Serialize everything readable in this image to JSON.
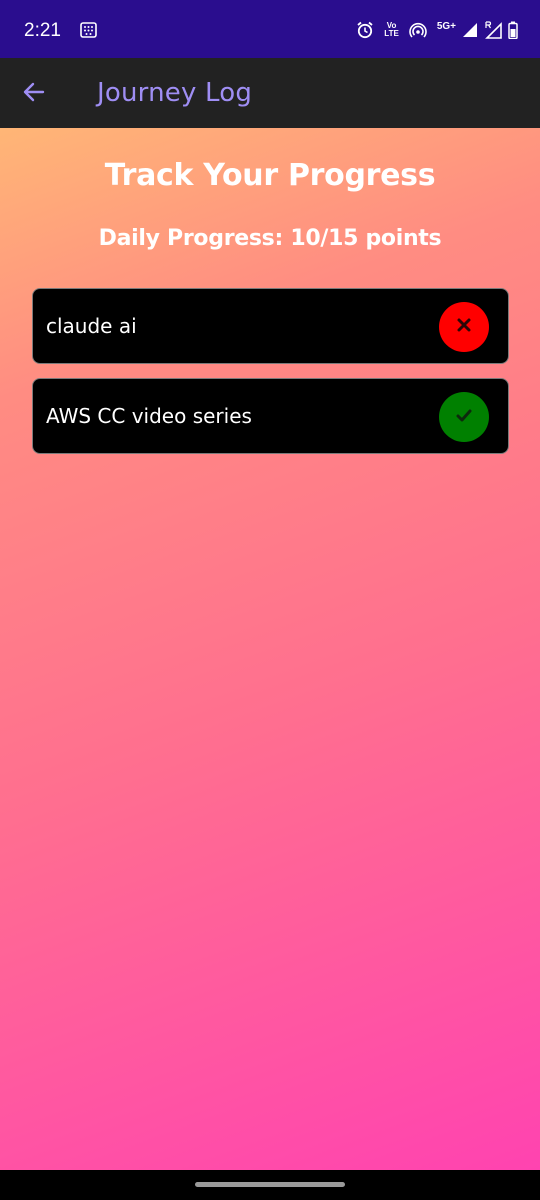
{
  "status_bar": {
    "time": "2:21",
    "volte_top": "Vo",
    "volte_bottom": "LTE",
    "network": "5G+",
    "icons": [
      "app-notification-icon",
      "alarm-icon",
      "volte-icon",
      "hotspot-icon",
      "signal-icon",
      "roaming-signal-icon",
      "battery-icon"
    ]
  },
  "app_bar": {
    "title": "Journey Log",
    "back_icon": "back-arrow-icon",
    "title_color": "#9f8ef4"
  },
  "main": {
    "heading": "Track Your Progress",
    "progress_text": "Daily Progress: 10/15 points",
    "tasks": [
      {
        "label": "claude ai",
        "status": "incomplete",
        "status_icon": "close-icon",
        "status_color": "#ff0000"
      },
      {
        "label": "AWS CC video series",
        "status": "complete",
        "status_icon": "checkmark-icon",
        "status_color": "#008000"
      }
    ]
  },
  "colors": {
    "status_bar_bg": "#2a0d8e",
    "app_bar_bg": "#222222",
    "gradient_start": "#ffb676",
    "gradient_end": "#ff43b0"
  }
}
